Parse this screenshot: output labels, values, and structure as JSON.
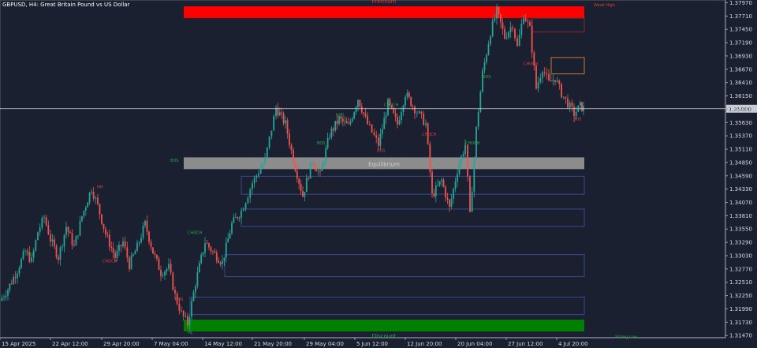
{
  "chart_data": {
    "type": "candlestick",
    "symbol": "GBPUSD,H4",
    "description": "Great Britain Pound vs US Dollar",
    "title": "GBPUSD, H4:  Great Britain Pound vs US Dollar",
    "ylim": [
      1.3155,
      1.379
    ],
    "yticks": [
      "1.37970",
      "1.37710",
      "1.37450",
      "1.37190",
      "1.36930",
      "1.36670",
      "1.36410",
      "1.36150",
      "1.35890",
      "1.35630",
      "1.35370",
      "1.35110",
      "1.34850",
      "1.34590",
      "1.34330",
      "1.34070",
      "1.33810",
      "1.33550",
      "1.33290",
      "1.33030",
      "1.32770",
      "1.32510",
      "1.32250",
      "1.31990",
      "1.31730",
      "1.31470"
    ],
    "xticks": [
      "15 Apr 2025",
      "22 Apr 12:00",
      "29 Apr 20:00",
      "7 May 04:00",
      "14 May 12:00",
      "21 May 20:00",
      "29 May 04:00",
      "5 Jun 12:00",
      "12 Jun 20:00",
      "20 Jun 04:00",
      "27 Jun 12:00",
      "4 Jul 20:00"
    ],
    "current_price": "1.35900",
    "current_price_value": 1.359,
    "price_path": [
      [
        0,
        1.3215
      ],
      [
        10,
        1.3238
      ],
      [
        22,
        1.3275
      ],
      [
        32,
        1.3312
      ],
      [
        40,
        1.3292
      ],
      [
        48,
        1.335
      ],
      [
        56,
        1.3378
      ],
      [
        64,
        1.3335
      ],
      [
        74,
        1.33
      ],
      [
        84,
        1.336
      ],
      [
        94,
        1.332
      ],
      [
        104,
        1.338
      ],
      [
        116,
        1.3435
      ],
      [
        124,
        1.34
      ],
      [
        134,
        1.3345
      ],
      [
        146,
        1.33
      ],
      [
        156,
        1.333
      ],
      [
        164,
        1.3285
      ],
      [
        174,
        1.332
      ],
      [
        184,
        1.3365
      ],
      [
        194,
        1.331
      ],
      [
        204,
        1.327
      ],
      [
        214,
        1.328
      ],
      [
        222,
        1.3225
      ],
      [
        230,
        1.319
      ],
      [
        238,
        1.317
      ],
      [
        248,
        1.325
      ],
      [
        260,
        1.333
      ],
      [
        270,
        1.331
      ],
      [
        282,
        1.329
      ],
      [
        294,
        1.3365
      ],
      [
        306,
        1.339
      ],
      [
        320,
        1.3445
      ],
      [
        336,
        1.349
      ],
      [
        350,
        1.3592
      ],
      [
        362,
        1.356
      ],
      [
        372,
        1.349
      ],
      [
        384,
        1.342
      ],
      [
        396,
        1.349
      ],
      [
        406,
        1.346
      ],
      [
        418,
        1.354
      ],
      [
        430,
        1.357
      ],
      [
        442,
        1.3555
      ],
      [
        454,
        1.361
      ],
      [
        466,
        1.356
      ],
      [
        480,
        1.352
      ],
      [
        492,
        1.36
      ],
      [
        504,
        1.356
      ],
      [
        514,
        1.362
      ],
      [
        526,
        1.359
      ],
      [
        540,
        1.356
      ],
      [
        548,
        1.342
      ],
      [
        560,
        1.345
      ],
      [
        570,
        1.3395
      ],
      [
        580,
        1.347
      ],
      [
        590,
        1.352
      ],
      [
        596,
        1.338
      ],
      [
        604,
        1.355
      ],
      [
        612,
        1.366
      ],
      [
        622,
        1.374
      ],
      [
        630,
        1.378
      ],
      [
        640,
        1.373
      ],
      [
        650,
        1.3755
      ],
      [
        656,
        1.371
      ],
      [
        664,
        1.3775
      ],
      [
        672,
        1.3745
      ],
      [
        680,
        1.363
      ],
      [
        688,
        1.367
      ],
      [
        696,
        1.364
      ],
      [
        704,
        1.365
      ],
      [
        712,
        1.362
      ],
      [
        720,
        1.36
      ],
      [
        728,
        1.358
      ],
      [
        736,
        1.3595
      ],
      [
        740,
        1.359
      ]
    ],
    "zones": [
      {
        "name": "Premium",
        "color": "#ff0000",
        "x0": 233,
        "x1": 741,
        "y0": 1.379,
        "y1": 1.3767,
        "label": "Premium"
      },
      {
        "name": "Equilibrium",
        "color": "#8c8c8c",
        "x0": 233,
        "x1": 741,
        "y0": 1.3495,
        "y1": 1.3472,
        "label": "Equilibrium"
      },
      {
        "name": "Discount",
        "color": "#008000",
        "x0": 233,
        "x1": 741,
        "y0": 1.3178,
        "y1": 1.3155,
        "label": "Discount"
      }
    ],
    "order_blocks": [
      {
        "color": "#8a2a2a",
        "x0": 675,
        "x1": 741,
        "y0": 1.3767,
        "y1": 1.374
      },
      {
        "color": "#c07a30",
        "x0": 699,
        "x1": 741,
        "y0": 1.369,
        "y1": 1.3658
      },
      {
        "color": "#3a4a8a",
        "x0": 306,
        "x1": 741,
        "y0": 1.3458,
        "y1": 1.3423
      },
      {
        "color": "#3a4a8a",
        "x0": 306,
        "x1": 741,
        "y0": 1.3394,
        "y1": 1.336
      },
      {
        "color": "#3a4a8a",
        "x0": 285,
        "x1": 741,
        "y0": 1.3305,
        "y1": 1.3262
      },
      {
        "color": "#3a4a8a",
        "x0": 241,
        "x1": 741,
        "y0": 1.3222,
        "y1": 1.3188
      }
    ],
    "structure_labels": [
      {
        "text": "BOS",
        "x": 32,
        "y": 1.3303,
        "color": "#2aa84a"
      },
      {
        "text": "BOS",
        "x": 216,
        "y": 1.3486,
        "color": "#2aa84a"
      },
      {
        "text": "HL",
        "x": 238,
        "y": 1.315,
        "color": "#2aa84a"
      },
      {
        "text": "CHOCH",
        "x": 238,
        "y": 1.3345,
        "color": "#2aa84a"
      },
      {
        "text": "BOS",
        "x": 402,
        "y": 1.352,
        "color": "#2aa84a"
      },
      {
        "text": "BOS",
        "x": 426,
        "y": 1.3575,
        "color": "#2aa84a"
      },
      {
        "text": "CHOCH",
        "x": 487,
        "y": 1.3595,
        "color": "#2aa84a"
      },
      {
        "text": "CHOCH",
        "x": 590,
        "y": 1.352,
        "color": "#2aa84a"
      },
      {
        "text": "BOS",
        "x": 612,
        "y": 1.365,
        "color": "#2aa84a"
      },
      {
        "text": "HH",
        "x": 123,
        "y": 1.3435,
        "color": "#e03c3c"
      },
      {
        "text": "CHOCH",
        "x": 130,
        "y": 1.329,
        "color": "#e03c3c"
      },
      {
        "text": "BOS",
        "x": 222,
        "y": 1.3215,
        "color": "#e03c3c"
      },
      {
        "text": "CHOCH",
        "x": 535,
        "y": 1.3537,
        "color": "#e03c3c"
      },
      {
        "text": "BOS",
        "x": 478,
        "y": 1.3506,
        "color": "#e03c3c"
      },
      {
        "text": "CHOCH",
        "x": 664,
        "y": 1.3675,
        "color": "#e03c3c"
      },
      {
        "text": "BOS",
        "x": 727,
        "y": 1.3567,
        "color": "#e03c3c"
      },
      {
        "text": "Weak High",
        "x": 753,
        "y": 1.379,
        "color": "#e03c3c"
      },
      {
        "text": "Strong Low",
        "x": 780,
        "y": 1.3142,
        "color": "#2aa84a"
      }
    ]
  }
}
